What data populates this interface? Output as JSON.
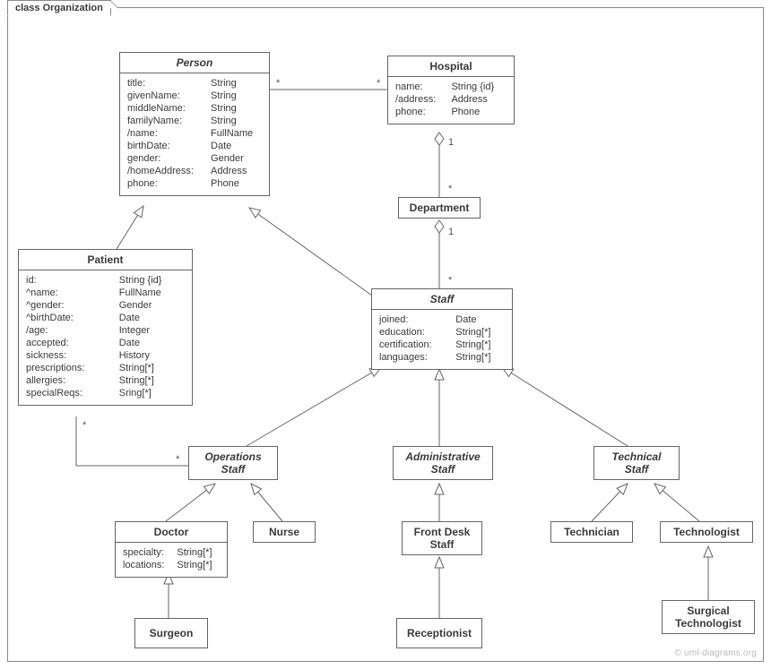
{
  "frame": {
    "label": "class Organization"
  },
  "watermark": "© uml-diagrams.org",
  "classes": {
    "person": {
      "name": "Person",
      "attrs": [
        {
          "n": "title:",
          "t": "String"
        },
        {
          "n": "givenName:",
          "t": "String"
        },
        {
          "n": "middleName:",
          "t": "String"
        },
        {
          "n": "familyName:",
          "t": "String"
        },
        {
          "n": "/name:",
          "t": "FullName"
        },
        {
          "n": "birthDate:",
          "t": "Date"
        },
        {
          "n": "gender:",
          "t": "Gender"
        },
        {
          "n": "/homeAddress:",
          "t": "Address"
        },
        {
          "n": "phone:",
          "t": "Phone"
        }
      ]
    },
    "hospital": {
      "name": "Hospital",
      "attrs": [
        {
          "n": "name:",
          "t": "String {id}"
        },
        {
          "n": "/address:",
          "t": "Address"
        },
        {
          "n": "phone:",
          "t": "Phone"
        }
      ]
    },
    "department": {
      "name": "Department"
    },
    "patient": {
      "name": "Patient",
      "attrs": [
        {
          "n": "id:",
          "t": "String {id}"
        },
        {
          "n": "^name:",
          "t": "FullName"
        },
        {
          "n": "^gender:",
          "t": "Gender"
        },
        {
          "n": "^birthDate:",
          "t": "Date"
        },
        {
          "n": "/age:",
          "t": "Integer"
        },
        {
          "n": "accepted:",
          "t": "Date"
        },
        {
          "n": "sickness:",
          "t": "History"
        },
        {
          "n": "prescriptions:",
          "t": "String[*]"
        },
        {
          "n": "allergies:",
          "t": "String[*]"
        },
        {
          "n": "specialReqs:",
          "t": "Sring[*]"
        }
      ]
    },
    "staff": {
      "name": "Staff",
      "attrs": [
        {
          "n": "joined:",
          "t": "Date"
        },
        {
          "n": "education:",
          "t": "String[*]"
        },
        {
          "n": "certification:",
          "t": "String[*]"
        },
        {
          "n": "languages:",
          "t": "String[*]"
        }
      ]
    },
    "operationsStaff": {
      "name1": "Operations",
      "name2": "Staff"
    },
    "administrativeStaff": {
      "name1": "Administrative",
      "name2": "Staff"
    },
    "technicalStaff": {
      "name1": "Technical",
      "name2": "Staff"
    },
    "doctor": {
      "name": "Doctor",
      "attrs": [
        {
          "n": "specialty:",
          "t": "String[*]"
        },
        {
          "n": "locations:",
          "t": "String[*]"
        }
      ]
    },
    "nurse": {
      "name": "Nurse"
    },
    "frontDeskStaff": {
      "name1": "Front Desk",
      "name2": "Staff"
    },
    "receptionist": {
      "name": "Receptionist"
    },
    "technician": {
      "name": "Technician"
    },
    "technologist": {
      "name": "Technologist"
    },
    "surgicalTechnologist": {
      "name1": "Surgical",
      "name2": "Technologist"
    },
    "surgeon": {
      "name": "Surgeon"
    }
  },
  "multiplicities": {
    "personHospital_left": "*",
    "personHospital_right": "*",
    "hospitalDept_top": "1",
    "hospitalDept_bottom": "*",
    "deptStaff_top": "1",
    "deptStaff_bottom": "*",
    "patientOps_left": "*",
    "patientOps_right": "*"
  }
}
